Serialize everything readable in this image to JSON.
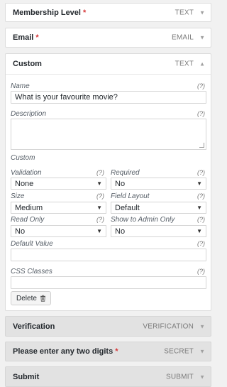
{
  "fields_top": [
    {
      "title": "Membership Level",
      "required": true,
      "type": "TEXT",
      "arrow": "▼"
    },
    {
      "title": "Email",
      "required": true,
      "type": "EMAIL",
      "arrow": "▼"
    }
  ],
  "custom": {
    "title": "Custom",
    "type": "TEXT",
    "arrow": "▲",
    "help": "(?)",
    "name_label": "Name",
    "name_value": "What is your favourite movie?",
    "description_label": "Description",
    "description_value": "",
    "custom_label": "Custom",
    "validation_label": "Validation",
    "validation_value": "None",
    "required_label": "Required",
    "required_value": "No",
    "size_label": "Size",
    "size_value": "Medium",
    "field_layout_label": "Field Layout",
    "field_layout_value": "Default",
    "read_only_label": "Read Only",
    "read_only_value": "No",
    "show_admin_label": "Show to Admin Only",
    "show_admin_value": "No",
    "default_value_label": "Default Value",
    "default_value_value": "",
    "css_label": "CSS Classes",
    "css_value": "",
    "delete_label": "Delete",
    "select_caret": "▼"
  },
  "fields_bottom": [
    {
      "title": "Verification",
      "required": false,
      "type": "VERIFICATION",
      "arrow": "▼"
    },
    {
      "title": "Please enter any two digits",
      "required": true,
      "type": "SECRET",
      "arrow": "▼"
    },
    {
      "title": "Submit",
      "required": false,
      "type": "SUBMIT",
      "arrow": "▼"
    }
  ],
  "required_mark": "*"
}
